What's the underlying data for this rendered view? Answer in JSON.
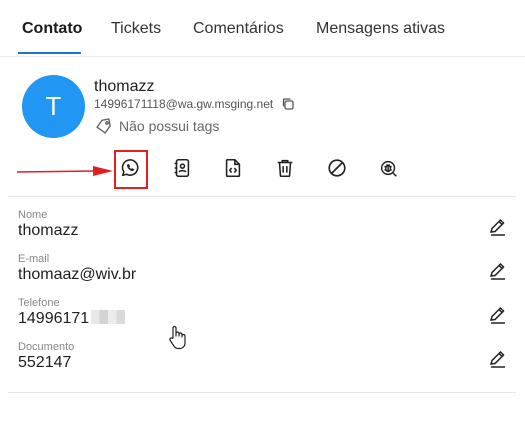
{
  "tabs": [
    {
      "label": "Contato",
      "active": true
    },
    {
      "label": "Tickets",
      "active": false
    },
    {
      "label": "Comentários",
      "active": false
    },
    {
      "label": "Mensagens ativas",
      "active": false
    }
  ],
  "contact": {
    "avatar_letter": "T",
    "avatar_color": "#2196f3",
    "name": "thomazz",
    "id": "14996171118@wa.gw.msging.net",
    "tags_text": "Não possui tags"
  },
  "actions": [
    {
      "icon": "whatsapp-icon",
      "highlighted": true
    },
    {
      "icon": "contact-card-icon"
    },
    {
      "icon": "code-file-icon"
    },
    {
      "icon": "trash-icon"
    },
    {
      "icon": "block-icon"
    },
    {
      "icon": "bug-search-icon"
    }
  ],
  "fields": [
    {
      "label": "Nome",
      "value": "thomazz"
    },
    {
      "label": "E-mail",
      "value": "thomaaz@wiv.br"
    },
    {
      "label": "Telefone",
      "value": "14996171"
    },
    {
      "label": "Documento",
      "value": "552147"
    }
  ],
  "colors": {
    "accent": "#1976d2",
    "annotation": "#e02020"
  }
}
